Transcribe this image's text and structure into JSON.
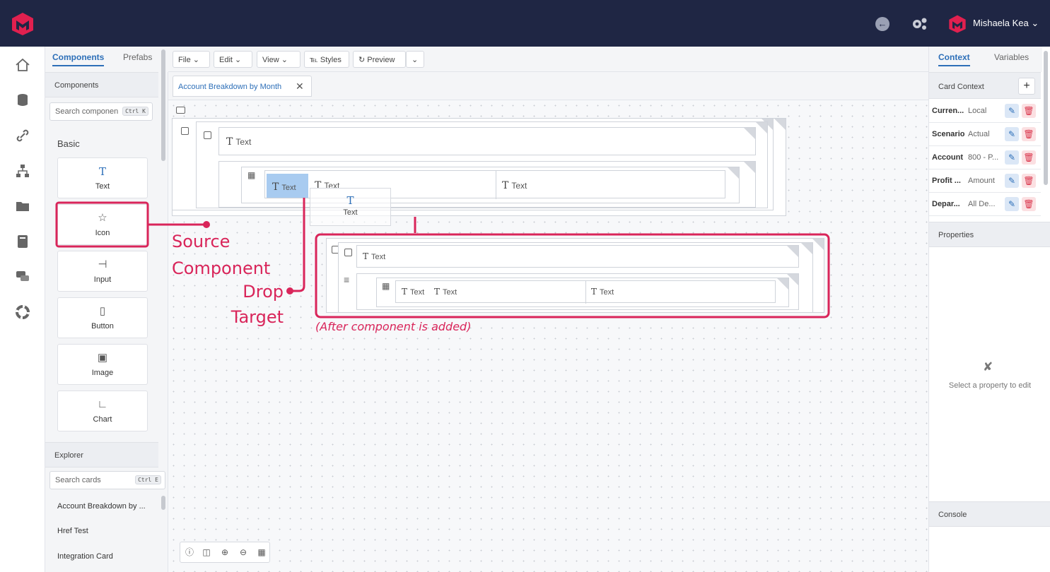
{
  "header": {
    "user_name": "Mishaela Kea"
  },
  "left_panel": {
    "tabs": [
      {
        "label": "Components",
        "active": true
      },
      {
        "label": "Prefabs",
        "active": false
      }
    ],
    "components_header": "Components",
    "search_placeholder": "Search componen",
    "search_shortcut": "Ctrl K",
    "group_label": "Basic",
    "components": [
      {
        "label": "Text",
        "icon": "text-icon"
      },
      {
        "label": "Icon",
        "icon": "star-icon"
      },
      {
        "label": "Input",
        "icon": "input-icon"
      },
      {
        "label": "Button",
        "icon": "mouse-icon"
      },
      {
        "label": "Image",
        "icon": "image-icon"
      },
      {
        "label": "Chart",
        "icon": "chart-icon"
      }
    ],
    "explorer_header": "Explorer",
    "explorer_search_placeholder": "Search cards",
    "explorer_shortcut": "Ctrl E",
    "explorer_items": [
      "Account Breakdown by ...",
      "Href Test",
      "Integration Card"
    ]
  },
  "toolbar": {
    "file": "File",
    "edit": "Edit",
    "view": "View",
    "styles": "Styles",
    "preview": "Preview"
  },
  "document_tab": {
    "label": "Account Breakdown by Month"
  },
  "canvas": {
    "text_label": "Text",
    "drag_ghost_label": "Text",
    "annotations": {
      "source": "Source\nComponent",
      "drop": "Drop\nTarget",
      "after": "(After component is added)"
    }
  },
  "right_panel": {
    "tabs": [
      {
        "label": "Context",
        "active": true
      },
      {
        "label": "Variables",
        "active": false
      }
    ],
    "card_context_label": "Card Context",
    "context_rows": [
      {
        "key": "Curren...",
        "value": "Local"
      },
      {
        "key": "Scenario",
        "value": "Actual"
      },
      {
        "key": "Account",
        "value": "800 - P..."
      },
      {
        "key": "Profit ...",
        "value": "Amount"
      },
      {
        "key": "Depar...",
        "value": "All De..."
      }
    ],
    "properties_label": "Properties",
    "properties_empty": "Select a property to edit",
    "console_label": "Console"
  },
  "colors": {
    "topbar": "#1f2644",
    "accent": "#2d6fb8",
    "annotation": "#d9255a",
    "brand": "#e0204f"
  }
}
